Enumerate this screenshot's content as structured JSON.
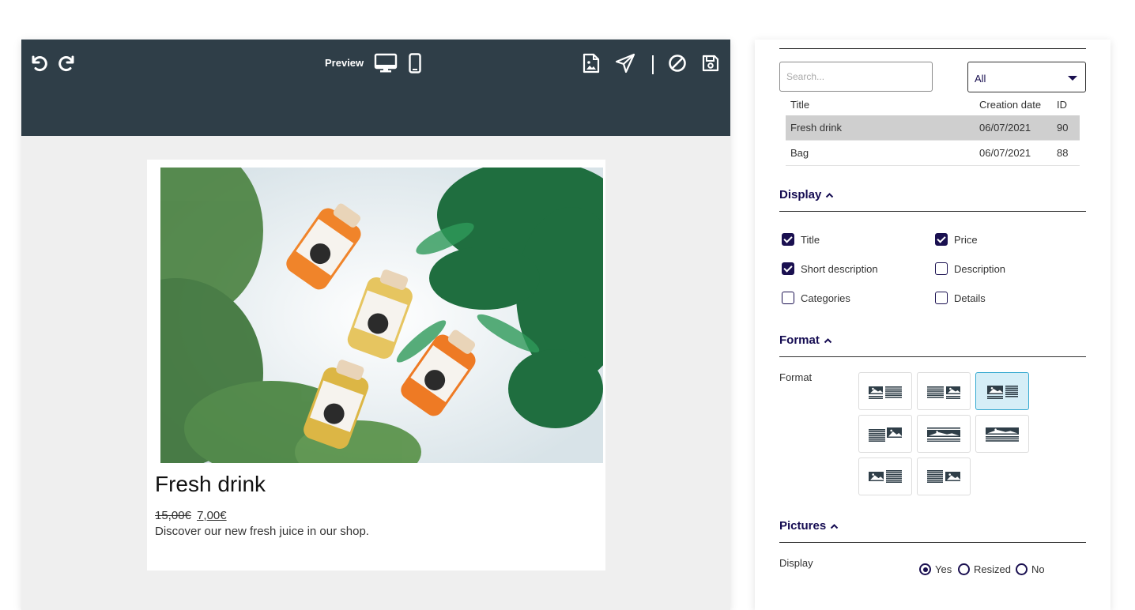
{
  "toolbar": {
    "preview_label": "Preview",
    "icons": [
      "undo-icon",
      "redo-icon",
      "desktop-icon",
      "mobile-icon",
      "image-file-icon",
      "send-icon",
      "cancel-icon",
      "save-icon"
    ]
  },
  "preview": {
    "product_title": "Fresh drink",
    "price_old": "15,00€",
    "price_new": "7,00€",
    "short_description": "Discover our new fresh juice in our shop."
  },
  "panel": {
    "search_placeholder": "Search...",
    "filter_value": "All",
    "table": {
      "headers": [
        "Title",
        "Creation date",
        "ID"
      ],
      "rows": [
        {
          "title": "Fresh drink",
          "date": "06/07/2021",
          "id": "90",
          "selected": true
        },
        {
          "title": "Bag",
          "date": "06/07/2021",
          "id": "88",
          "selected": false
        }
      ]
    },
    "display": {
      "title": "Display",
      "options": [
        {
          "label": "Title",
          "checked": true
        },
        {
          "label": "Price",
          "checked": true
        },
        {
          "label": "Short description",
          "checked": true
        },
        {
          "label": "Description",
          "checked": false
        },
        {
          "label": "Categories",
          "checked": false
        },
        {
          "label": "Details",
          "checked": false
        }
      ]
    },
    "format": {
      "title": "Format",
      "field_label": "Format",
      "selected_index": 2,
      "count": 8
    },
    "pictures": {
      "title": "Pictures",
      "field_label": "Display",
      "options": [
        "Yes",
        "Resized",
        "No"
      ],
      "selected": "Yes"
    }
  },
  "colors": {
    "toolbar_bg": "#2f3e48",
    "accent": "#1a1050",
    "selected_format": "#d5eef7"
  }
}
